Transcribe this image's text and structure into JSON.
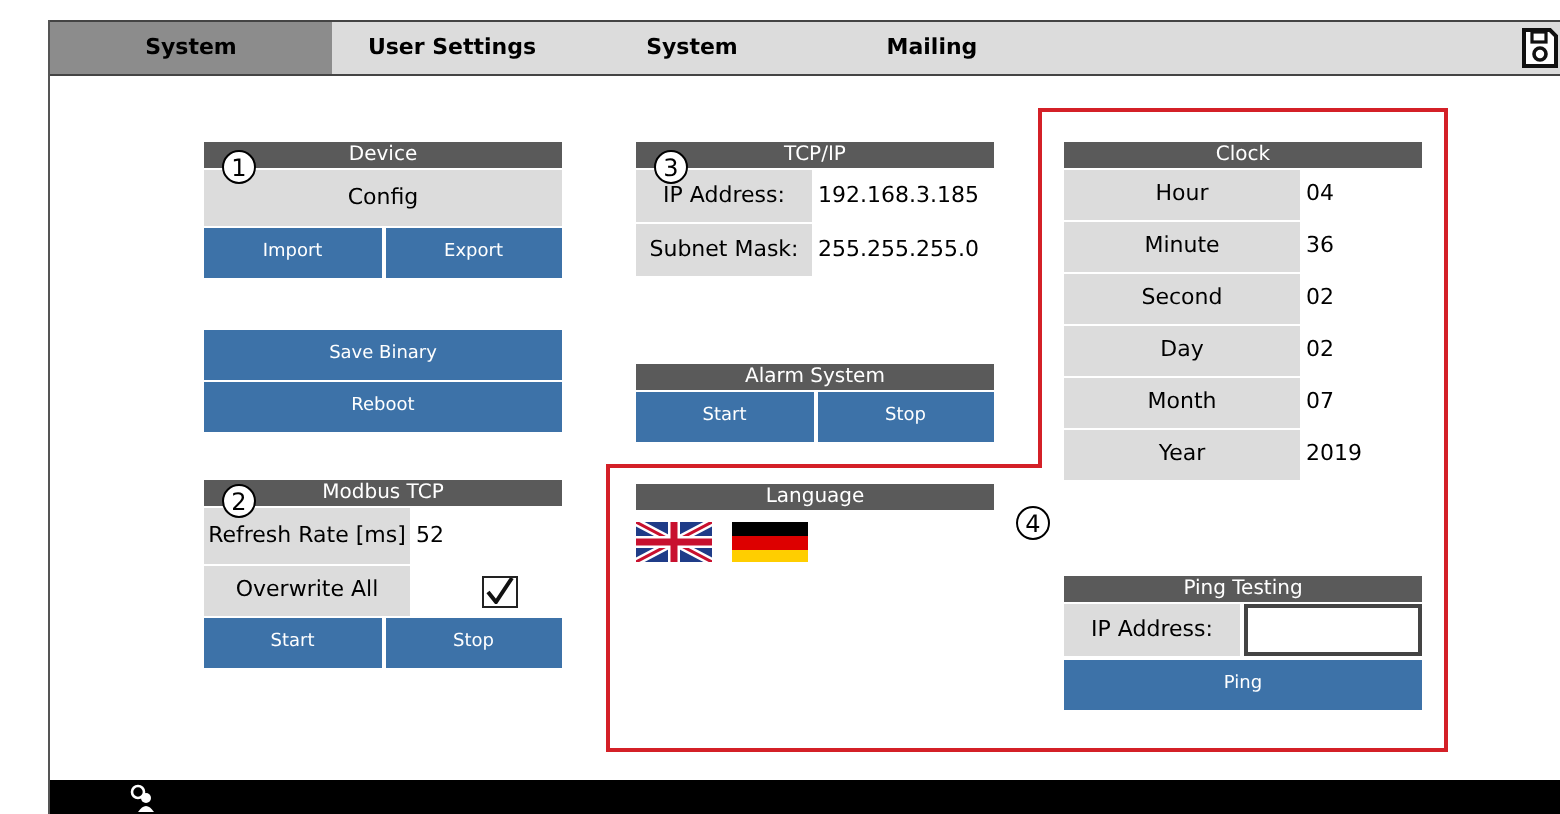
{
  "tabs": [
    {
      "label": "System",
      "selected": true
    },
    {
      "label": "User Settings",
      "selected": false
    },
    {
      "label": "System",
      "selected": false
    },
    {
      "label": "Mailing",
      "selected": false
    }
  ],
  "device": {
    "title": "Device",
    "config": "Config",
    "buttons": [
      "Import",
      "Export"
    ]
  },
  "actions": [
    "Save Binary",
    "Reboot"
  ],
  "modbus": {
    "title": "Modbus TCP",
    "refresh_label": "Refresh Rate [ms]",
    "refresh_value": "52",
    "overwrite_label": "Overwrite All",
    "overwrite_checked": true,
    "buttons": [
      "Start",
      "Stop"
    ]
  },
  "tcpip": {
    "title": "TCP/IP",
    "rows": [
      {
        "label": "IP Address:",
        "value": "192.168.3.185"
      },
      {
        "label": "Subnet Mask:",
        "value": "255.255.255.0"
      }
    ]
  },
  "alarm": {
    "title": "Alarm System",
    "buttons": [
      "Start",
      "Stop"
    ]
  },
  "language": {
    "title": "Language",
    "flags": [
      {
        "kind": "uk"
      },
      {
        "kind": "de"
      }
    ]
  },
  "clock": {
    "title": "Clock",
    "rows": [
      {
        "label": "Hour",
        "value": "04"
      },
      {
        "label": "Minute",
        "value": "36"
      },
      {
        "label": "Second",
        "value": "02"
      },
      {
        "label": "Day",
        "value": "02"
      },
      {
        "label": "Month",
        "value": "07"
      },
      {
        "label": "Year",
        "value": "2019"
      }
    ]
  },
  "ping": {
    "title": "Ping Testing",
    "label": "IP Address:",
    "button": "Ping"
  },
  "callouts": [
    "1",
    "2",
    "3",
    "4"
  ]
}
